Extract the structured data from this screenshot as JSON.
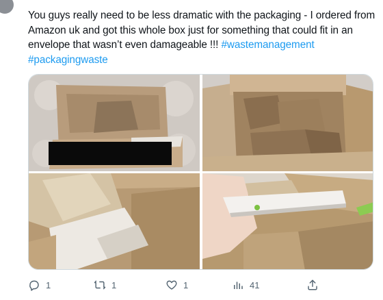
{
  "tweet": {
    "text_main": "You guys really need to be less dramatic with the packaging - I ordered from Amazon uk and got this whole box just for something that could fit in an envelope that wasn’t even damageable !!! ",
    "hashtags": [
      "#wastemanagement",
      "#packagingwaste"
    ]
  },
  "media": {
    "photos": [
      {
        "icon": "cardboard-box-photo",
        "alt": "box"
      },
      {
        "icon": "paper-filled-box-photo",
        "alt": "box"
      },
      {
        "icon": "open-box-item-photo",
        "alt": "box"
      },
      {
        "icon": "hand-holding-item-photo",
        "alt": "box"
      }
    ]
  },
  "actions": {
    "reply_count": "1",
    "retweet_count": "1",
    "like_count": "1",
    "views_count": "41"
  },
  "colors": {
    "text": "#0f1419",
    "hashtag": "#1d9bf0",
    "secondary": "#536471",
    "border": "#cfd9de"
  }
}
